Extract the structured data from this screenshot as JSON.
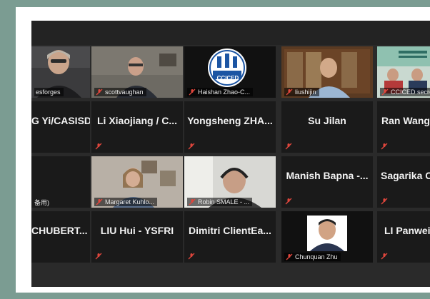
{
  "participants": [
    {
      "id": "p1",
      "label": "esforges"
    },
    {
      "id": "p2",
      "label": "scottvaughan"
    },
    {
      "id": "p3",
      "label": "Haishan Zhao-C..."
    },
    {
      "id": "p4",
      "label": "liushijin"
    },
    {
      "id": "p5",
      "label": "CCICED secretaria"
    },
    {
      "id": "p6",
      "name": "G Yi/CASISD"
    },
    {
      "id": "p7",
      "name": "Li Xiaojiang / C..."
    },
    {
      "id": "p8",
      "name": "Yongsheng  ZHA..."
    },
    {
      "id": "p9",
      "name": "Su Jilan"
    },
    {
      "id": "p10",
      "name": "Ran  Wang"
    },
    {
      "id": "p11",
      "label": "备用)"
    },
    {
      "id": "p12",
      "label": "Margaret Kuhlo..."
    },
    {
      "id": "p13",
      "label": "Robin SMALE - ..."
    },
    {
      "id": "p14",
      "name": "Manish  Bapna -..."
    },
    {
      "id": "p15",
      "name": "Sagarika  C"
    },
    {
      "id": "p16",
      "name": "CHUBERT..."
    },
    {
      "id": "p17",
      "name": "LIU Hui - YSFRI"
    },
    {
      "id": "p18",
      "name": "Dimitri  ClientEa..."
    },
    {
      "id": "p19",
      "label": "Chunquan Zhu"
    },
    {
      "id": "p20",
      "name": "LI Panwei"
    }
  ],
  "logo_text": "CCICED",
  "colors": {
    "active_border": "#d6e27a",
    "muted_mic": "#e0463c"
  }
}
